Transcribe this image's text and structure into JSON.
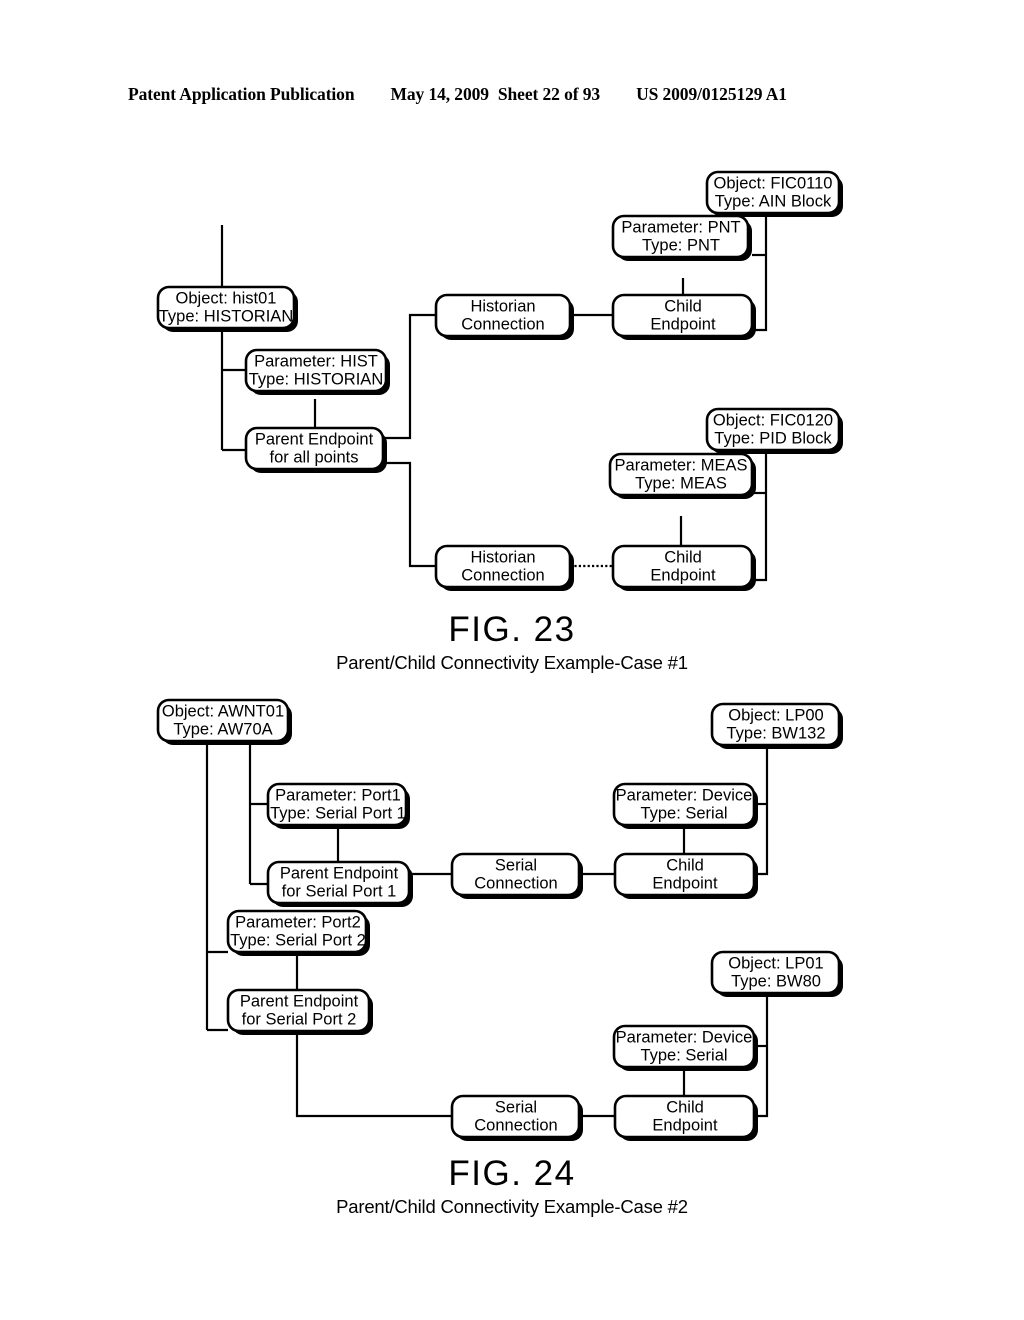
{
  "header": {
    "publication": "Patent Application Publication",
    "date": "May 14, 2009",
    "sheet": "Sheet 22 of 93",
    "patent_number": "US 2009/0125129 A1"
  },
  "figures": [
    {
      "id": "fig-23",
      "label": "FIG. 23",
      "subtitle": "Parent/Child Connectivity Example-Case #1",
      "nodes": {
        "hist01": {
          "line1": "Object: hist01",
          "line2": "Type: HISTORIAN"
        },
        "param_hist": {
          "line1": "Parameter: HIST",
          "line2": "Type: HISTORIAN"
        },
        "parent_endpoint": {
          "line1": "Parent Endpoint",
          "line2": "for all points"
        },
        "hist_conn_top": {
          "line1": "Historian",
          "line2": "Connection"
        },
        "hist_conn_bottom": {
          "line1": "Historian",
          "line2": "Connection"
        },
        "child_endpoint_top": {
          "line1": "Child",
          "line2": "Endpoint"
        },
        "child_endpoint_bottom": {
          "line1": "Child",
          "line2": "Endpoint"
        },
        "param_pnt": {
          "line1": "Parameter: PNT",
          "line2": "Type: PNT"
        },
        "param_meas": {
          "line1": "Parameter: MEAS",
          "line2": "Type: MEAS"
        },
        "fic0110": {
          "line1": "Object: FIC0110",
          "line2": "Type: AIN Block"
        },
        "fic0120": {
          "line1": "Object: FIC0120",
          "line2": "Type: PID Block"
        }
      }
    },
    {
      "id": "fig-24",
      "label": "FIG. 24",
      "subtitle": "Parent/Child Connectivity Example-Case #2",
      "nodes": {
        "awnt01": {
          "line1": "Object: AWNT01",
          "line2": "Type: AW70A"
        },
        "param_port1": {
          "line1": "Parameter: Port1",
          "line2": "Type: Serial Port 1"
        },
        "parent_endpoint_1": {
          "line1": "Parent Endpoint",
          "line2": "for Serial Port 1"
        },
        "param_port2": {
          "line1": "Parameter: Port2",
          "line2": "Type: Serial Port 2"
        },
        "parent_endpoint_2": {
          "line1": "Parent Endpoint",
          "line2": "for Serial Port 2"
        },
        "serial_conn_top": {
          "line1": "Serial",
          "line2": "Connection"
        },
        "serial_conn_bottom": {
          "line1": "Serial",
          "line2": "Connection"
        },
        "child_endpoint_top": {
          "line1": "Child",
          "line2": "Endpoint"
        },
        "child_endpoint_bottom": {
          "line1": "Child",
          "line2": "Endpoint"
        },
        "param_device_top": {
          "line1": "Parameter: Device",
          "line2": "Type: Serial"
        },
        "param_device_bottom": {
          "line1": "Parameter: Device",
          "line2": "Type: Serial"
        },
        "lp00": {
          "line1": "Object: LP00",
          "line2": "Type: BW132"
        },
        "lp01": {
          "line1": "Object: LP01",
          "line2": "Type: BW80"
        }
      }
    }
  ],
  "colors": {
    "stroke": "#000000",
    "background": "#ffffff"
  }
}
